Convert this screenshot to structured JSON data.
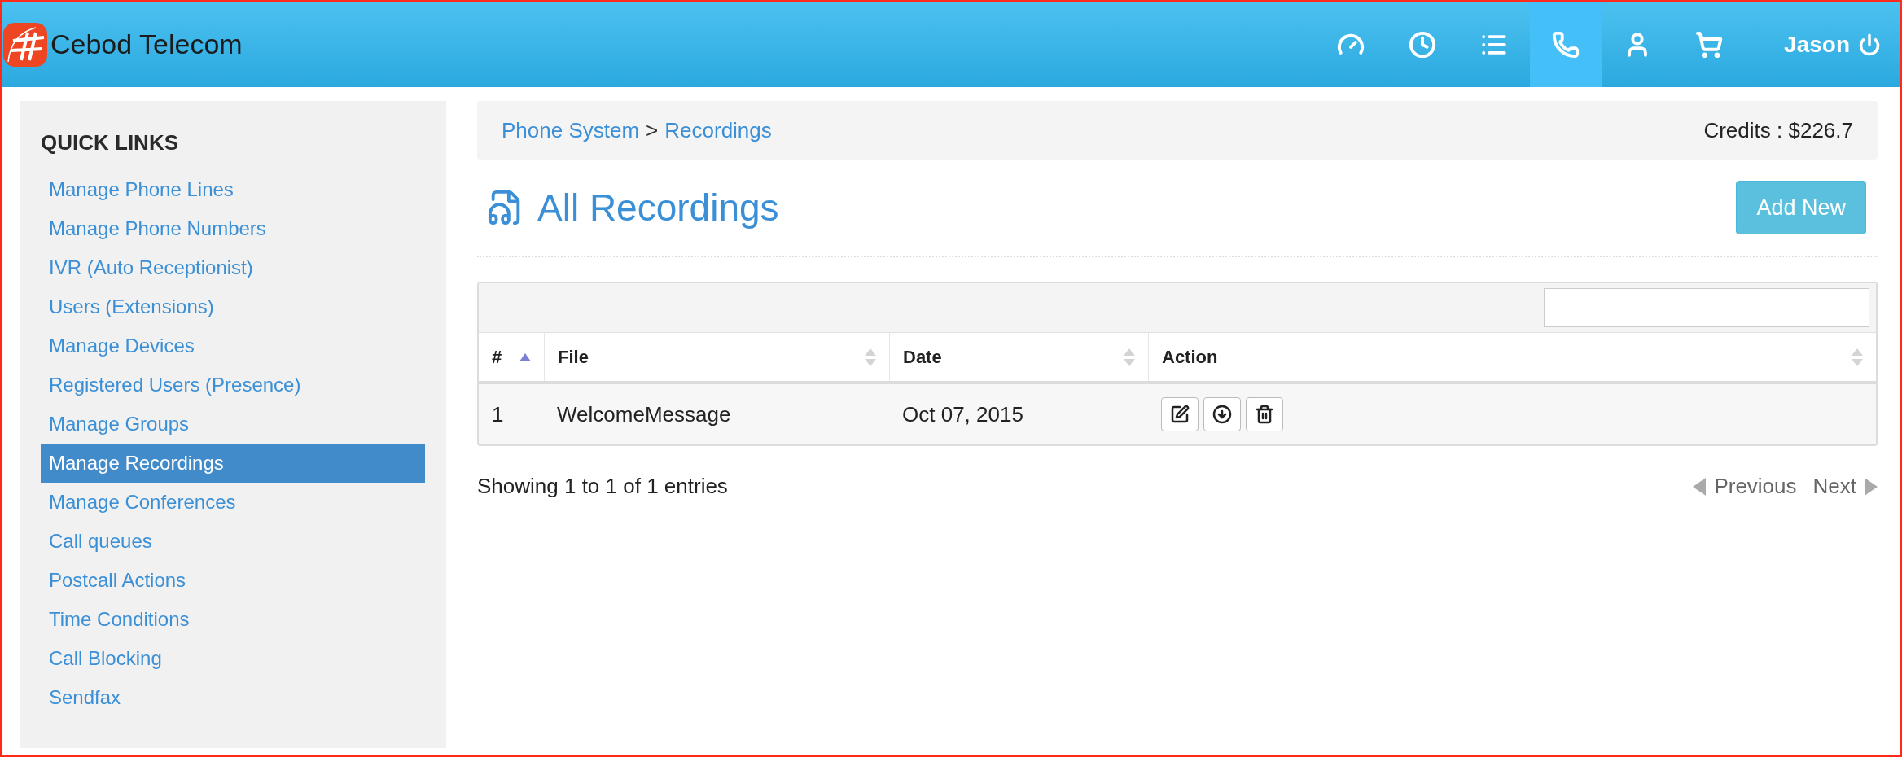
{
  "header": {
    "brand": "Cebod Telecom",
    "nav": [
      {
        "kind": "dashboard",
        "selected": false
      },
      {
        "kind": "history",
        "selected": false
      },
      {
        "kind": "list",
        "selected": false
      },
      {
        "kind": "phone",
        "selected": true
      },
      {
        "kind": "account",
        "selected": false
      },
      {
        "kind": "cart",
        "selected": false
      }
    ],
    "user": "Jason"
  },
  "sidebar": {
    "title": "QUICK LINKS",
    "items": [
      {
        "label": "Manage Phone Lines",
        "selected": false
      },
      {
        "label": "Manage Phone Numbers",
        "selected": false
      },
      {
        "label": "IVR (Auto Receptionist)",
        "selected": false
      },
      {
        "label": "Users (Extensions)",
        "selected": false
      },
      {
        "label": "Manage Devices",
        "selected": false
      },
      {
        "label": "Registered Users (Presence)",
        "selected": false
      },
      {
        "label": "Manage Groups",
        "selected": false
      },
      {
        "label": "Manage Recordings",
        "selected": true
      },
      {
        "label": "Manage Conferences",
        "selected": false
      },
      {
        "label": "Call queues",
        "selected": false
      },
      {
        "label": "Postcall Actions",
        "selected": false
      },
      {
        "label": "Time Conditions",
        "selected": false
      },
      {
        "label": "Call Blocking",
        "selected": false
      },
      {
        "label": "Sendfax",
        "selected": false
      }
    ]
  },
  "breadcrumb": {
    "items": [
      "Phone System",
      "Recordings"
    ],
    "separator": ">",
    "credits": "Credits : $226.7"
  },
  "page": {
    "title": "All Recordings",
    "add_button": "Add New"
  },
  "table": {
    "columns": [
      {
        "label": "#",
        "sorted": true
      },
      {
        "label": "File",
        "sorted": false
      },
      {
        "label": "Date",
        "sorted": false
      },
      {
        "label": "Action",
        "sorted": false
      }
    ],
    "rows": [
      {
        "cells": [
          "1",
          "WelcomeMessage",
          "Oct 07, 2015"
        ],
        "actions": [
          {
            "kind": "edit"
          },
          {
            "kind": "download"
          },
          {
            "kind": "delete"
          }
        ]
      }
    ]
  },
  "footer": {
    "info": "Showing 1 to 1 of 1 entries",
    "previous": "Previous",
    "next": "Next"
  }
}
